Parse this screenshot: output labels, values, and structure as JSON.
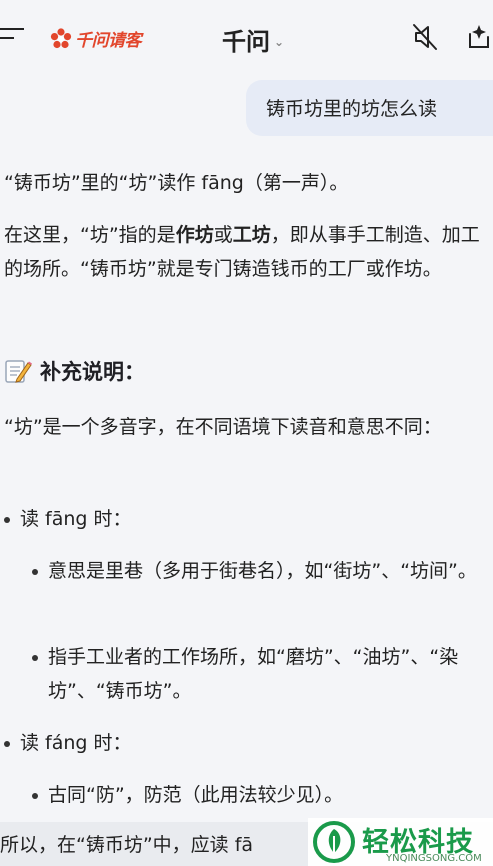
{
  "header": {
    "logo_text": "千问请客",
    "title": "千问",
    "caret": "⌄"
  },
  "user_message": "铸币坊里的坊怎么读",
  "answer": {
    "p1": "“铸币坊”里的“坊”读作 fāng（第一声）。",
    "p2_a": "在这里，“坊”指的是",
    "p2_b1": "作坊",
    "p2_c": "或",
    "p2_b2": "工坊",
    "p2_d": "，即从事手工制造、加工的场所。“铸币坊”就是专门铸造钱币的工厂或作坊。",
    "section_title": "补充说明：",
    "p3": "“坊”是一个多音字，在不同语境下读音和意思不同：",
    "bullets": [
      "读 fāng 时：",
      "意思是里巷（多用于街巷名），如“街坊”、“坊间”。",
      "指手工业者的工作场所，如“磨坊”、“油坊”、“染坊”、“铸币坊”。",
      "读 fáng 时：",
      "古同“防”，防范（此用法较少见）。"
    ]
  },
  "bottom_text": "所以，在“铸币坊”中，应读 fā",
  "watermark": {
    "title": "轻松科技",
    "sub": "YNQINGSONG.COM"
  },
  "colors": {
    "brand_red": "#e2462c",
    "watermark_green": "#1a9a4a",
    "user_bubble": "#e6ebf6"
  }
}
